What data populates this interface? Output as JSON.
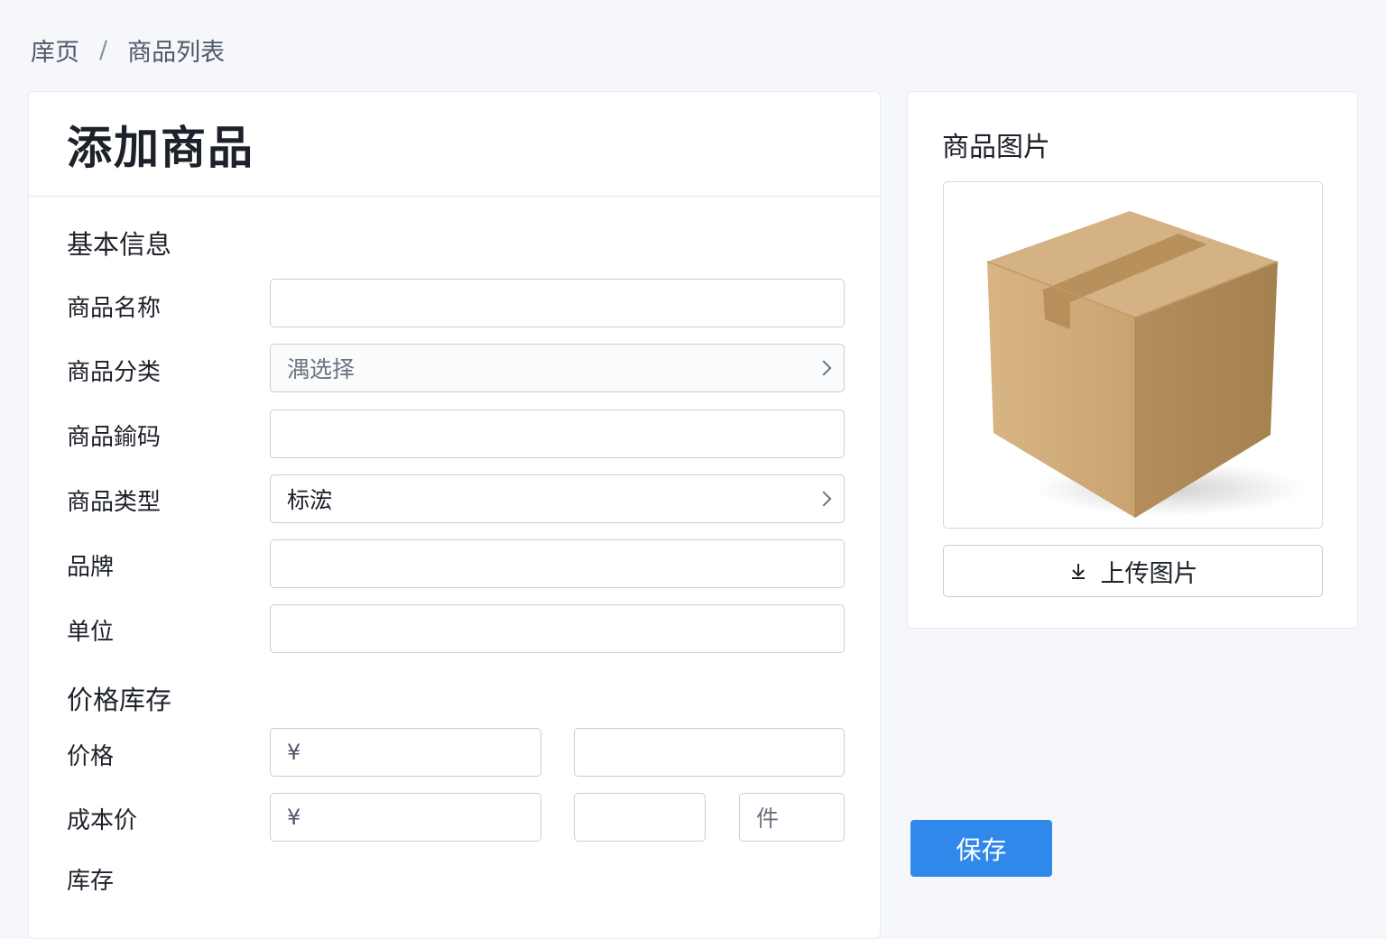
{
  "breadcrumb": {
    "home": "庠页",
    "separator": "/",
    "current": "商品列表"
  },
  "page": {
    "title": "添加商品"
  },
  "basic_info": {
    "section_title": "基本信息",
    "fields": {
      "name": {
        "label": "商品名称",
        "value": ""
      },
      "category": {
        "label": "商品分类",
        "placeholder": "湡选择"
      },
      "code": {
        "label": "商品鍮码",
        "value": ""
      },
      "type": {
        "label": "商品类型",
        "value": "标浤"
      },
      "brand": {
        "label": "品牌",
        "value": ""
      },
      "unit": {
        "label": "单位",
        "value": ""
      }
    }
  },
  "price_stock": {
    "section_title": "价格库存",
    "price": {
      "label": "价格",
      "currency": "¥"
    },
    "cost": {
      "label": "成本价",
      "currency": "¥",
      "unit_value": "件"
    },
    "stock": {
      "label": "库存"
    }
  },
  "image_panel": {
    "title": "商品图片",
    "upload_label": "上传图片",
    "image_icon": "cardboard-box"
  },
  "actions": {
    "save_label": "保存"
  },
  "colors": {
    "primary": "#2f88ea",
    "background": "#f5f7fa",
    "border": "#c9cdd4"
  }
}
